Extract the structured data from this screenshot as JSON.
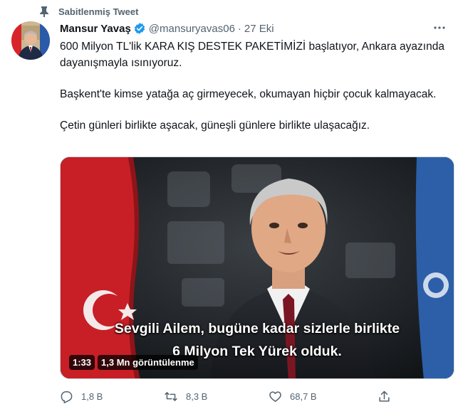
{
  "pinned": {
    "label": "Sabitlenmiş Tweet",
    "icon": "pin-icon"
  },
  "author": {
    "name": "Mansur Yavaş",
    "handle": "@mansuryavas06",
    "separator": "·",
    "time": "27 Eki",
    "verified": true
  },
  "tweet": {
    "paragraphs": [
      "600 Milyon TL'lik KARA KIŞ DESTEK PAKETİMİZİ başlatıyor, Ankara ayazında dayanışmayla ısınıyoruz.",
      "Başkent'te kimse yatağa aç girmeyecek, okumayan hiçbir çocuk kalmayacak.",
      "Çetin günleri birlikte aşacak, güneşli günlere birlikte ulaşacağız."
    ]
  },
  "video": {
    "subtitle_line1": "Sevgili Ailem, bugüne kadar sizlerle birlikte",
    "subtitle_line2": "6 Milyon Tek Yürek olduk.",
    "duration": "1:33",
    "views": "1,3 Mn görüntülenme"
  },
  "actions": {
    "reply_count": "1,8 B",
    "retweet_count": "8,3 B",
    "like_count": "68,7 B"
  },
  "colors": {
    "accent": "#1d9bf0",
    "secondary_text": "#536471",
    "flag_red": "#d8232a"
  }
}
